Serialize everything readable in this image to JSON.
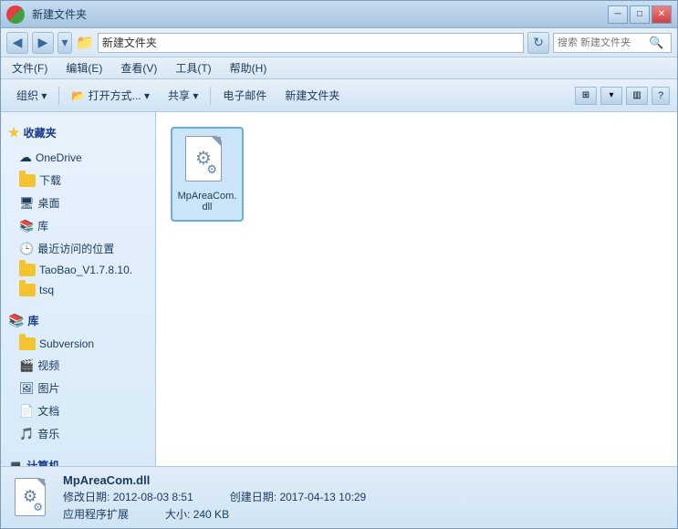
{
  "window": {
    "title": "新建文件夹",
    "title_icon": "📁",
    "min_btn": "─",
    "max_btn": "□",
    "close_btn": "✕"
  },
  "address_bar": {
    "back_btn": "◀",
    "forward_btn": "▶",
    "dropdown_btn": "▾",
    "path": "新建文件夹",
    "refresh_btn": "↻",
    "search_placeholder": "搜索 新建文件夹"
  },
  "menu": {
    "items": [
      "文件(F)",
      "编辑(E)",
      "查看(V)",
      "工具(T)",
      "帮助(H)"
    ]
  },
  "toolbar": {
    "organize_label": "组织 ▾",
    "open_label": "📂 打开方式... ▾",
    "share_label": "共享 ▾",
    "email_label": "电子邮件",
    "newfolder_label": "新建文件夹"
  },
  "sidebar": {
    "favorites_label": "收藏夹",
    "favorites_items": [
      {
        "label": "OneDrive",
        "icon": "cloud"
      },
      {
        "label": "下载",
        "icon": "folder"
      },
      {
        "label": "桌面",
        "icon": "desktop"
      },
      {
        "label": "库",
        "icon": "lib"
      },
      {
        "label": "最近访问的位置",
        "icon": "recent"
      },
      {
        "label": "TaoBao_V1.7.8.10.",
        "icon": "folder"
      },
      {
        "label": "tsq",
        "icon": "folder"
      }
    ],
    "library_label": "库",
    "library_items": [
      {
        "label": "Subversion",
        "icon": "folder"
      },
      {
        "label": "视频",
        "icon": "video"
      },
      {
        "label": "图片",
        "icon": "picture"
      },
      {
        "label": "文档",
        "icon": "doc"
      },
      {
        "label": "音乐",
        "icon": "music"
      }
    ],
    "computer_label": "计算机"
  },
  "files": [
    {
      "name": "MpAreaCom.dll",
      "type": "dll",
      "selected": true
    }
  ],
  "status_bar": {
    "filename": "MpAreaCom.dll",
    "type": "应用程序扩展",
    "modified_label": "修改日期:",
    "modified_value": "2012-08-03 8:51",
    "created_label": "创建日期:",
    "created_value": "2017-04-13 10:29",
    "size_label": "大小:",
    "size_value": "240 KB"
  }
}
